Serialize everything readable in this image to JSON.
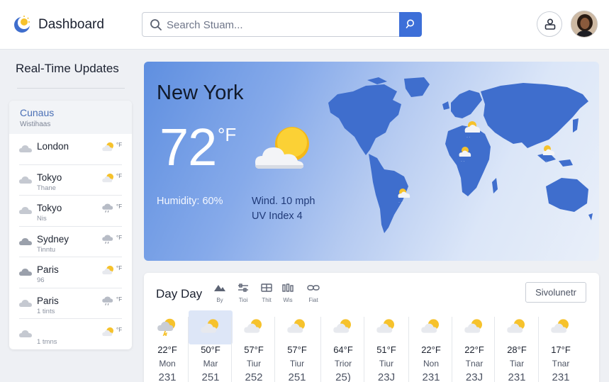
{
  "header": {
    "app_title": "Dashboard",
    "search_placeholder": "Search Stuam...",
    "logo_icon": "sun-moon-logo-icon",
    "search_icon": "search-icon",
    "user_icon": "user-icon"
  },
  "sidebar": {
    "title": "Real-Time Updates",
    "panel_title": "Cunaus",
    "panel_subtitle": "Wistihaas",
    "cities": [
      {
        "name": "London",
        "sub": "",
        "icon": "partly-sunny-icon",
        "deg": "°F"
      },
      {
        "name": "Tokyo",
        "sub": "Thane",
        "icon": "partly-sunny-icon",
        "deg": "°F"
      },
      {
        "name": "Tokyo",
        "sub": "Nis",
        "icon": "rain-cloud-icon",
        "deg": "°F"
      },
      {
        "name": "Sydney",
        "sub": "Tinntu",
        "icon": "rain-cloud-icon",
        "deg": "°F"
      },
      {
        "name": "Paris",
        "sub": "96",
        "icon": "partly-sunny-icon",
        "deg": "°F"
      },
      {
        "name": "Paris",
        "sub": "1 tints",
        "icon": "rain-cloud-icon",
        "deg": "°F"
      },
      {
        "name": "",
        "sub": "1 tmns",
        "icon": "partly-sunny-icon",
        "deg": "°F"
      }
    ]
  },
  "hero": {
    "city": "New York",
    "temp": "72",
    "unit": "°F",
    "humidity": "Humidity: 60%",
    "wind": "Wind. 10 mph",
    "uv": "UV Index 4"
  },
  "forecast": {
    "title": "Day Day",
    "button": "Sivolunetr",
    "tools": [
      {
        "icon": "mountain-icon",
        "label": "By"
      },
      {
        "icon": "sliders-icon",
        "label": "Tioi"
      },
      {
        "icon": "grid-icon",
        "label": "Thit"
      },
      {
        "icon": "bars-icon",
        "label": "Wis"
      },
      {
        "icon": "link-icon",
        "label": "Fiat"
      }
    ],
    "days": [
      {
        "temp": "22°F",
        "label": "Mon",
        "num": "231",
        "icon": "thunder-sun-icon"
      },
      {
        "temp": "50°F",
        "label": "Mar",
        "num": "251",
        "icon": "partly-sunny-icon"
      },
      {
        "temp": "57°F",
        "label": "Tiur",
        "num": "252",
        "icon": "partly-sunny-icon"
      },
      {
        "temp": "57°F",
        "label": "Tiur",
        "num": "251",
        "icon": "partly-sunny-icon"
      },
      {
        "temp": "64°F",
        "label": "Trior",
        "num": "25)",
        "icon": "partly-sunny-icon"
      },
      {
        "temp": "51°F",
        "label": "Tiur",
        "num": "23J",
        "icon": "partly-sunny-icon"
      },
      {
        "temp": "22°F",
        "label": "Non",
        "num": "231",
        "icon": "partly-sunny-icon"
      },
      {
        "temp": "22°F",
        "label": "Tnar",
        "num": "23J",
        "icon": "partly-sunny-icon"
      },
      {
        "temp": "28°F",
        "label": "Tiar",
        "num": "231",
        "icon": "partly-sunny-icon"
      },
      {
        "temp": "17°F",
        "label": "Tnar",
        "num": "231",
        "icon": "partly-sunny-icon"
      }
    ]
  },
  "colors": {
    "accent": "#3d6fd8",
    "map": "#3f6ecd",
    "sun": "#f6c22c"
  }
}
